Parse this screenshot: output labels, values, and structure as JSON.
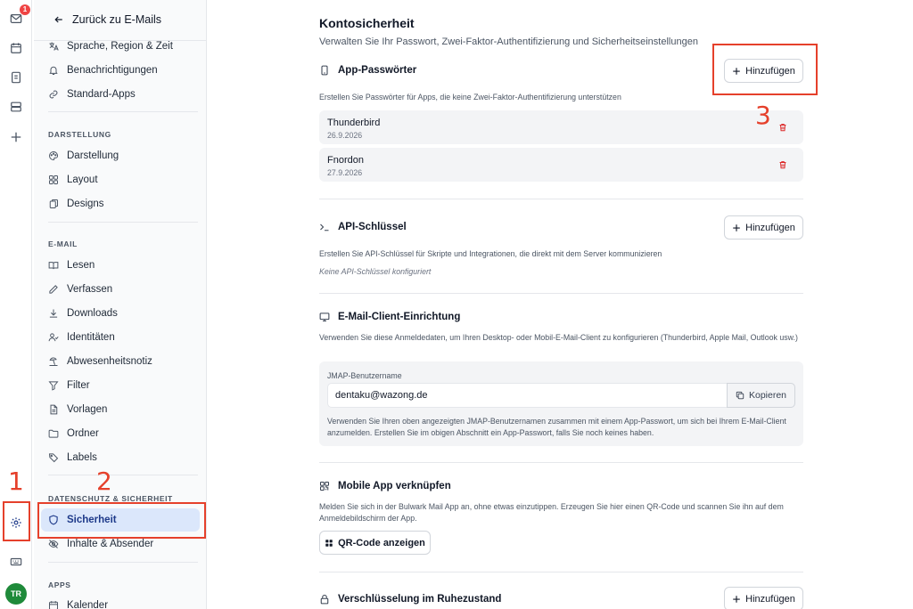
{
  "rail": {
    "mail_badge": "1",
    "avatar": "TR"
  },
  "sidebar": {
    "back_label": "Zurück zu E-Mails",
    "items_general": [
      {
        "label": "Sprache, Region & Zeit",
        "icon": "language-icon"
      },
      {
        "label": "Benachrichtigungen",
        "icon": "bell-icon"
      },
      {
        "label": "Standard-Apps",
        "icon": "link-icon"
      }
    ],
    "section_appearance": "DARSTELLUNG",
    "items_appearance": [
      {
        "label": "Darstellung",
        "icon": "palette-icon"
      },
      {
        "label": "Layout",
        "icon": "layout-grid-icon"
      },
      {
        "label": "Designs",
        "icon": "designs-icon"
      }
    ],
    "section_email": "E-MAIL",
    "items_email": [
      {
        "label": "Lesen",
        "icon": "book-open-icon"
      },
      {
        "label": "Verfassen",
        "icon": "pencil-icon"
      },
      {
        "label": "Downloads",
        "icon": "download-icon"
      },
      {
        "label": "Identitäten",
        "icon": "identities-icon"
      },
      {
        "label": "Abwesenheitsnotiz",
        "icon": "vacation-icon"
      },
      {
        "label": "Filter",
        "icon": "filter-icon"
      },
      {
        "label": "Vorlagen",
        "icon": "template-icon"
      },
      {
        "label": "Ordner",
        "icon": "folder-icon"
      },
      {
        "label": "Labels",
        "icon": "tag-icon"
      }
    ],
    "section_privacy": "DATENSCHUTZ & SICHERHEIT",
    "items_privacy": [
      {
        "label": "Sicherheit",
        "icon": "shield-icon",
        "active": true
      },
      {
        "label": "Inhalte & Absender",
        "icon": "eye-off-icon"
      }
    ],
    "section_apps": "APPS",
    "items_apps": [
      {
        "label": "Kalender",
        "icon": "calendar-icon"
      }
    ]
  },
  "main": {
    "title": "Kontosicherheit",
    "subtitle": "Verwalten Sie Ihr Passwort, Zwei-Faktor-Authentifizierung und Sicherheitseinstellungen",
    "app_passwords": {
      "title": "App-Passwörter",
      "add_label": "Hinzufügen",
      "description": "Erstellen Sie Passwörter für Apps, die keine Zwei-Faktor-Authentifizierung unterstützen",
      "items": [
        {
          "name": "Thunderbird",
          "date": "26.9.2026"
        },
        {
          "name": "Fnordon",
          "date": "27.9.2026"
        }
      ]
    },
    "api_keys": {
      "title": "API-Schlüssel",
      "add_label": "Hinzufügen",
      "description": "Erstellen Sie API-Schlüssel für Skripte und Integrationen, die direkt mit dem Server kommunizieren",
      "empty": "Keine API-Schlüssel konfiguriert"
    },
    "client_setup": {
      "title": "E-Mail-Client-Einrichtung",
      "description": "Verwenden Sie diese Anmeldedaten, um Ihren Desktop- oder Mobil-E-Mail-Client zu konfigurieren (Thunderbird, Apple Mail, Outlook usw.)",
      "jmap_label": "JMAP-Benutzername",
      "jmap_value": "dentaku@wazong.de",
      "copy_label": "Kopieren",
      "hint": "Verwenden Sie Ihren oben angezeigten JMAP-Benutzernamen zusammen mit einem App-Passwort, um sich bei Ihrem E-Mail-Client anzumelden. Erstellen Sie im obigen Abschnitt ein App-Passwort, falls Sie noch keines haben."
    },
    "mobile_app": {
      "title": "Mobile App verknüpfen",
      "description": "Melden Sie sich in der Bulwark Mail App an, ohne etwas einzutippen. Erzeugen Sie hier einen QR-Code und scannen Sie ihn auf dem Anmeldebildschirm der App.",
      "qr_label": "QR-Code anzeigen"
    },
    "encryption": {
      "title": "Verschlüsselung im Ruhezustand",
      "add_label": "Hinzufügen"
    }
  },
  "annotations": {
    "step1": "1",
    "step2": "2",
    "step3": "3",
    "color": "#e5402b"
  }
}
